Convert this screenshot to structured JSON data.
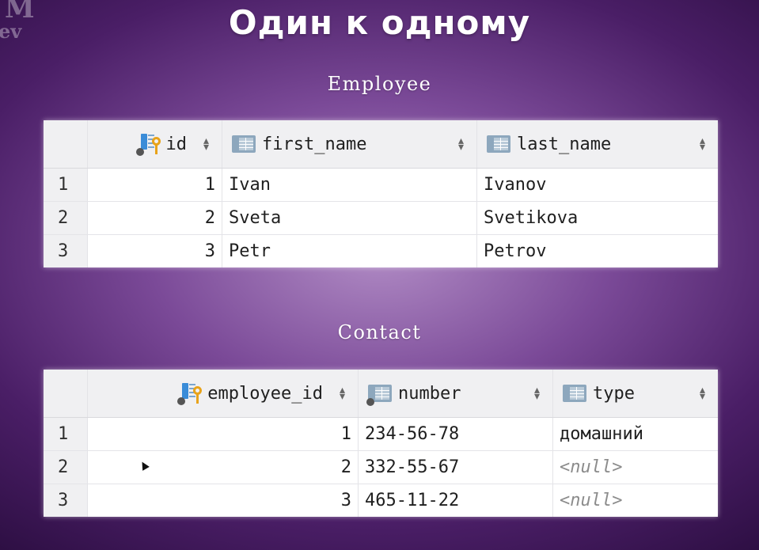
{
  "logo": {
    "line1": "M",
    "line2": "ev"
  },
  "page_title": "Один к одному",
  "employee": {
    "title": "Employee",
    "columns": [
      "id",
      "first_name",
      "last_name"
    ],
    "rows": [
      {
        "num": "1",
        "id": "1",
        "first_name": "Ivan",
        "last_name": "Ivanov"
      },
      {
        "num": "2",
        "id": "2",
        "first_name": "Sveta",
        "last_name": "Svetikova"
      },
      {
        "num": "3",
        "id": "3",
        "first_name": "Petr",
        "last_name": "Petrov"
      }
    ]
  },
  "contact": {
    "title": "Contact",
    "columns": [
      "employee_id",
      "number",
      "type"
    ],
    "rows": [
      {
        "num": "1",
        "employee_id": "1",
        "number": "234-56-78",
        "type": "домашний"
      },
      {
        "num": "2",
        "employee_id": "2",
        "number": "332-55-67",
        "type": "<null>"
      },
      {
        "num": "3",
        "employee_id": "3",
        "number": "465-11-22",
        "type": "<null>"
      }
    ]
  },
  "icons": {
    "primary_key": "primary-key-column-icon",
    "column": "table-column-icon",
    "sort": "sort-updown-icon"
  },
  "colors": {
    "background": "#5b2a7a",
    "null_text": "#8c8c8c"
  }
}
